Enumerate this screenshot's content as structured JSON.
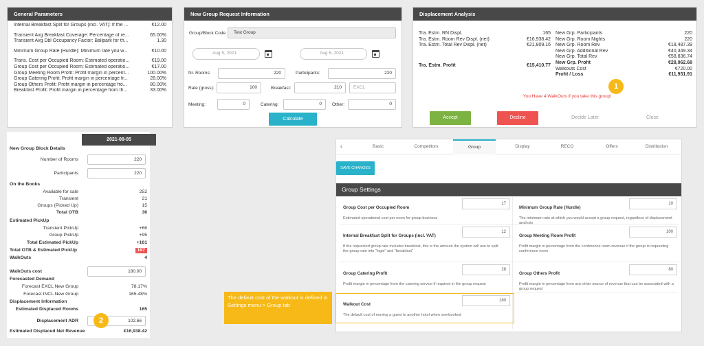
{
  "general": {
    "title": "General Parameters",
    "rows": [
      {
        "label": "Internal Breakfast Split for Groups (incl. VAT): If the ...",
        "value": "€12.00"
      },
      {
        "label": "",
        "value": ""
      },
      {
        "label": "Transient Avg Breakfast Coverage: Percentage of re...",
        "value": "65.00%"
      },
      {
        "label": "Transient Avg Dbl Occupancy Factor: Ballpark for th...",
        "value": "1.30"
      },
      {
        "label": "",
        "value": ""
      },
      {
        "label": "Minimum Group Rate (Hurdle): Minimum rate you w...",
        "value": "€10.00"
      },
      {
        "label": "",
        "value": ""
      },
      {
        "label": "Trans. Cost per Occupied Room: Estimated operatio...",
        "value": "€19.00"
      },
      {
        "label": "Group Cost per Occupied Room: Estimated operatio...",
        "value": "€17.00"
      },
      {
        "label": "Group Meeting Room Profit: Profit margin in percent...",
        "value": "100.00%"
      },
      {
        "label": "Group Catering Profit: Profit margin in percentage fr...",
        "value": "28.00%"
      },
      {
        "label": "Group Others Profit: Profit margin in percentage fro...",
        "value": "80.00%"
      },
      {
        "label": "Breakfast Profit: Profit margin in percentage from th...",
        "value": "33.00%"
      }
    ]
  },
  "request": {
    "title": "New Group Request Information",
    "block_code_label": "Group/Block Code",
    "block_code_value": "Test Group",
    "date_from": "Aug 5, 2021",
    "date_to": "Aug 6, 2021",
    "rooms_label": "Nr. Rooms:",
    "rooms_value": "220",
    "participants_label": "Participants:",
    "participants_value": "220",
    "rate_label": "Rate (gross):",
    "rate_value": "100",
    "breakfast_label": "Breakfast:",
    "breakfast_value": "210",
    "breakfast_option": "EXCL",
    "meeting_label": "Meeting:",
    "meeting_value": "0",
    "catering_label": "Catering:",
    "catering_value": "0",
    "other_label": "Other:",
    "other_value": "0",
    "calculate_label": "Calculate"
  },
  "displacement": {
    "title": "Displacement Analysis",
    "left": [
      {
        "label": "Tra. Estm. RN Displ.",
        "value": "165"
      },
      {
        "label": "Tra. Estm. Room Rev Displ. (net)",
        "value": "€16,938.42"
      },
      {
        "label": "Tra. Estm. Total Rev Displ. (net)",
        "value": "€21,809.16"
      }
    ],
    "profit_label": "Tra. Estm. Profit",
    "profit_value": "€15,410.77",
    "right": [
      {
        "label": "New Grp. Participants",
        "value": "220",
        "bold": false
      },
      {
        "label": "New Grp. Room Nights",
        "value": "220",
        "bold": false
      },
      {
        "label": "New Grp. Room Rev",
        "value": "€18,487.39",
        "bold": false
      },
      {
        "label": "New Grp. Additional Rev",
        "value": "€40,349.34",
        "bold": false
      },
      {
        "label": "New Grp. Total Rev",
        "value": "€58,836.74",
        "bold": false
      },
      {
        "label": "New Grp. Profit",
        "value": "€28,062.68",
        "bold": true
      },
      {
        "label": "Walkouts Cost",
        "value": "€720.00",
        "bold": false
      },
      {
        "label": "Profit / Loss",
        "value": "€11,931.91",
        "bold": true
      }
    ],
    "warning": "You Have 4 WalkOuts if you take this group!",
    "badge": "1",
    "accept_label": "Accept",
    "decline_label": "Decline",
    "decide_later_label": "Decide Later",
    "close_label": "Close"
  },
  "block": {
    "date": "2021-08-05",
    "details_title": "New Group Block Details",
    "rooms_label": "Number of Rooms",
    "rooms_value": "220",
    "participants_label": "Participants",
    "participants_value": "220",
    "on_books_title": "On the Books",
    "available_label": "Available for sale",
    "available_value": "252",
    "transient_label": "Transient",
    "transient_value": "21",
    "groups_label": "Groups (Picked Up)",
    "groups_value": "15",
    "total_otb_label": "Total OTB",
    "total_otb_value": "36",
    "pickup_title": "Estimated PickUp",
    "tr_pickup_label": "Transient PickUp",
    "tr_pickup_value": "+66",
    "gr_pickup_label": "Group PickUp",
    "gr_pickup_value": "+95",
    "total_pickup_label": "Total Estimated PickUp",
    "total_pickup_value": "+161",
    "total_otb_est_label": "Total OTB & Estimated PickUp",
    "total_otb_est_value": "197",
    "walkouts_label": "WalkOuts",
    "walkouts_value": "4",
    "walkouts_cost_label": "WalkOuts cost",
    "walkouts_cost_value": "180.00",
    "forecast_title": "Forecasted Demand",
    "excl_label": "Forecast EXCL New Group",
    "excl_value": "78.17%",
    "incl_label": "Forecast INCL New Group",
    "incl_value": "165.48%",
    "displacement_title": "Displacement Information",
    "displaced_rooms_label": "Estimated Displaced Rooms",
    "displaced_rooms_value": "165",
    "adr_label": "Displacement ADR",
    "adr_value": "102.66",
    "net_rev_label": "Estimated Displaced Net Revenue",
    "net_rev_value": "€16,938.42",
    "badge": "2"
  },
  "callout": {
    "text": "The default cost of the walkout is defined in Settings menu > Group tab"
  },
  "settings": {
    "back_icon": "chevron-left-icon",
    "tabs": [
      "Basic",
      "Competitors",
      "Group",
      "Display",
      "RECO",
      "Offers",
      "Distribution"
    ],
    "active_tab": "Group",
    "save_label": "SAVE CHANGES",
    "section_title": "Group Settings",
    "fields": [
      {
        "label": "Group Cost per Occupied Room",
        "value": "17",
        "desc": "Estimated operational cost per room for group business"
      },
      {
        "label": "Minimum Group Rate (Hurdle)",
        "value": "10",
        "desc": "The minimum rate at which you would accept a group request, regardless of displacement analysis"
      },
      {
        "label": "Internal Breakfast Split for Groups (incl. VAT)",
        "value": "12",
        "desc": "If the requested group rate includes breakfast, this is the amount the system will use to split the group rate into \"logis\" and \"breakfast\""
      },
      {
        "label": "Group Meeting Room Profit",
        "value": "100",
        "desc": "Profit margin in percentage from the conference room revenue if the group is requesting conference room"
      },
      {
        "label": "Group Catering Profit",
        "value": "28",
        "desc": "Profit margin in percentage from the catering service if required in the group request"
      },
      {
        "label": "Group Others Profit",
        "value": "80",
        "desc": "Profit margin in percentage from any other source of revenue that can be associated with a group request"
      },
      {
        "label": "Walkout Cost",
        "value": "180",
        "desc": "The default cost of moving a guest to another hotel when overbooked"
      }
    ]
  },
  "colors": {
    "header": "#484848",
    "teal": "#29b2c9",
    "accept": "#7cb342",
    "decline": "#ef5350",
    "badge": "#f6b917",
    "warning": "#e53935"
  }
}
